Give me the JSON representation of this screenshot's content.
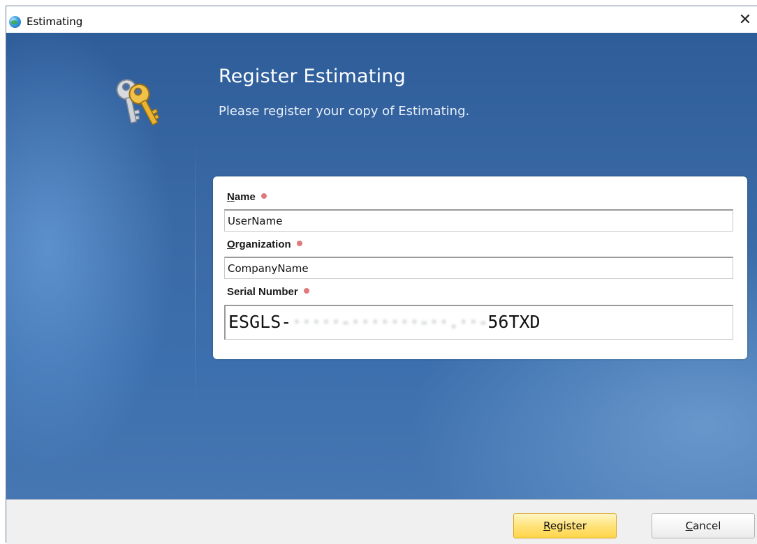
{
  "window": {
    "title": "Estimating",
    "close_glyph": "✕",
    "icon": "globe-icon"
  },
  "header": {
    "heading": "Register Estimating",
    "subheading": "Please register your copy of Estimating.",
    "icon": "keys-icon"
  },
  "form": {
    "name": {
      "label_access": "N",
      "label_rest": "ame",
      "value": "UserName"
    },
    "organization": {
      "label_access": "O",
      "label_rest": "rganization",
      "value": "CompanyName"
    },
    "serial": {
      "label": "Serial Number",
      "prefix": "ESGLS-",
      "obscured": "·····-·······-··.··-",
      "suffix": "56TXD"
    }
  },
  "footer": {
    "register_access": "R",
    "register_rest": "egister",
    "cancel_access": "C",
    "cancel_rest": "ancel"
  },
  "colors": {
    "background_blue": "#3a6aa6",
    "required_dot": "#e07a7a",
    "register_button": "#ffe27a"
  }
}
